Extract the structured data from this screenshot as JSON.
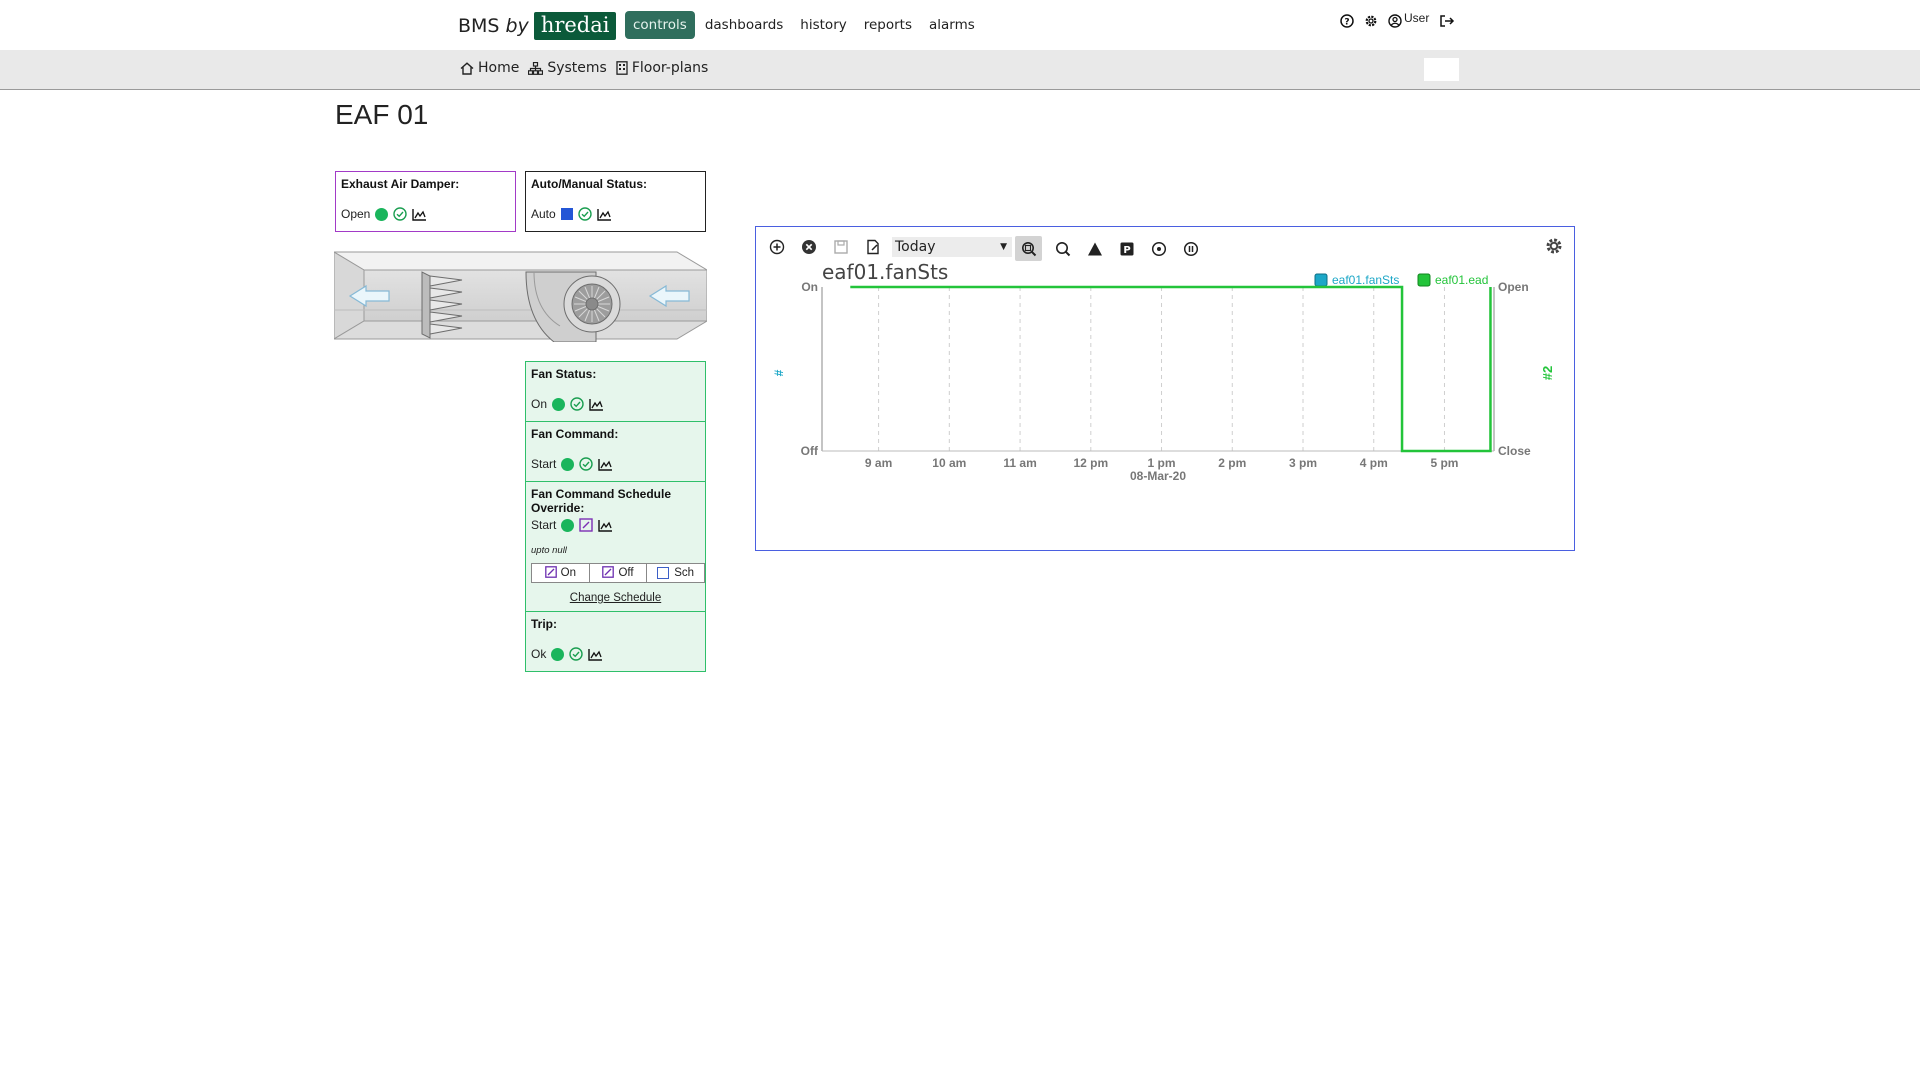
{
  "brand": {
    "name": "BMS",
    "by": "by",
    "logo": "hredai"
  },
  "nav": {
    "items": [
      "controls",
      "dashboards",
      "history",
      "reports",
      "alarms"
    ],
    "active": "controls"
  },
  "top_icons": {
    "help": "help-icon",
    "settings": "gear-icon",
    "user_label": "User",
    "logout": "logout-icon"
  },
  "breadcrumb": {
    "home": "Home",
    "systems": "Systems",
    "floorplans": "Floor-plans"
  },
  "page_title": "EAF 01",
  "cards": {
    "damper": {
      "label": "Exhaust Air Damper:",
      "value": "Open"
    },
    "auto_manual": {
      "label": "Auto/Manual Status:",
      "value": "Auto"
    },
    "fan_status": {
      "label": "Fan Status:",
      "value": "On"
    },
    "fan_command": {
      "label": "Fan Command:",
      "value": "Start"
    },
    "fan_override": {
      "label": "Fan Command Schedule Override:",
      "value": "Start",
      "note": "upto null",
      "buttons": [
        "On",
        "Off",
        "Sch"
      ],
      "link": "Change Schedule"
    },
    "trip": {
      "label": "Trip:",
      "value": "Ok"
    }
  },
  "colors": {
    "status_green": "#1ab55c",
    "auto_blue": "#2456d6",
    "series_fan": "#1ca7c7",
    "series_damper": "#23c43a",
    "brand_green": "#0b5a3a"
  },
  "chart_toolbar": {
    "range": "Today"
  },
  "chart_data": {
    "type": "line",
    "title": "eaf01.fanSts",
    "legend": [
      "eaf01.fanSts",
      "eaf01.ead"
    ],
    "legend_position": "top-right",
    "y_left": {
      "label": "#",
      "ticks": [
        "On",
        "Off"
      ]
    },
    "y_right": {
      "label": "#2",
      "ticks": [
        "Open",
        "Close"
      ]
    },
    "x_ticks": [
      "9 am",
      "10 am",
      "11 am",
      "12 pm",
      "1 pm",
      "2 pm",
      "3 pm",
      "4 pm",
      "5 pm"
    ],
    "x_date": "08-Mar-20",
    "x_range": [
      8.2,
      17.7
    ],
    "grid": true,
    "series": [
      {
        "name": "eaf01.ead",
        "color": "#23c43a",
        "points": [
          [
            8.6,
            1
          ],
          [
            16.4,
            1
          ],
          [
            16.4,
            0
          ],
          [
            17.65,
            0
          ],
          [
            17.65,
            1
          ]
        ]
      }
    ]
  }
}
